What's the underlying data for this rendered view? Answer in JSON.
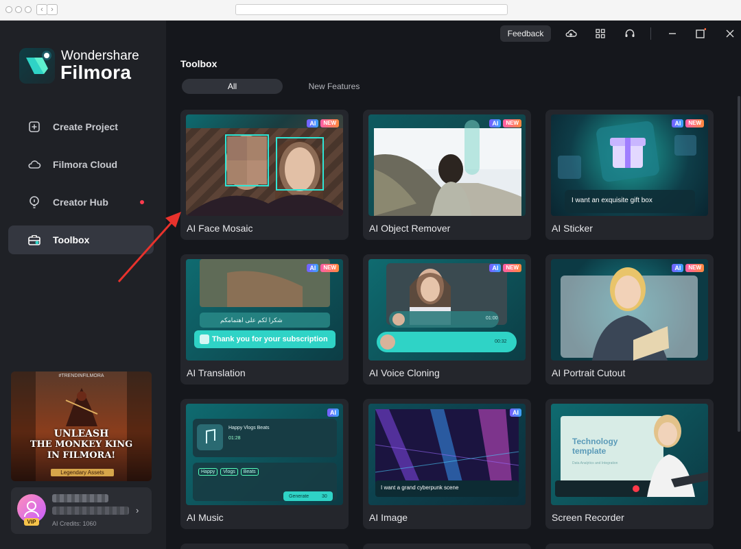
{
  "app": {
    "brand_top": "Wondershare",
    "brand_main": "Filmora",
    "feedback": "Feedback"
  },
  "sidebar": {
    "items": [
      {
        "label": "Create Project",
        "icon": "plus-square-icon"
      },
      {
        "label": "Filmora Cloud",
        "icon": "cloud-icon"
      },
      {
        "label": "Creator Hub",
        "icon": "bulb-icon"
      },
      {
        "label": "Toolbox",
        "icon": "toolbox-icon"
      }
    ],
    "promo": {
      "tag": "#TRENDINFILMORA",
      "line1": "UNLEASH",
      "line2": "THE MONKEY KING",
      "line3": "IN FILMORA!",
      "badge": "Legendary Assets"
    },
    "user": {
      "vip": "VIP",
      "credits": "AI Credits: 1060"
    }
  },
  "main": {
    "title": "Toolbox",
    "tabs": [
      "All",
      "New Features"
    ],
    "cards": [
      {
        "label": "AI Face Mosaic",
        "ai": "AI",
        "new": "NEW"
      },
      {
        "label": "AI Object Remover",
        "ai": "AI",
        "new": "NEW"
      },
      {
        "label": "AI Sticker",
        "ai": "AI",
        "new": "NEW",
        "caption": "I want an exquisite gift box"
      },
      {
        "label": "AI Translation",
        "ai": "AI",
        "new": "NEW",
        "caption": "Thank you for your subscription",
        "caption_ar": "شكرا لكم على اهتمامكم"
      },
      {
        "label": "AI Voice Cloning",
        "ai": "AI",
        "new": "NEW",
        "time1": "01:00",
        "time2": "00:32"
      },
      {
        "label": "AI Portrait Cutout",
        "ai": "AI",
        "new": "NEW"
      },
      {
        "label": "AI Music",
        "ai": "AI",
        "song": "Happy Vlogs Beats",
        "dur": "01:28",
        "chips": [
          "Happy",
          "Vlogs",
          "Beats"
        ],
        "generate": "Generate",
        "cost": "30"
      },
      {
        "label": "AI Image",
        "ai": "AI",
        "caption": "I want a grand cyberpunk scene"
      },
      {
        "label": "Screen Recorder",
        "slide_title": "Technology template",
        "slide_sub": "Data Analytics and Integration"
      }
    ]
  },
  "colors": {
    "accent": "#2fd3c6",
    "bg": "#15171c",
    "sidebar": "#1f2126",
    "dot": "#ff3b4e",
    "arrow": "#e8322c"
  }
}
